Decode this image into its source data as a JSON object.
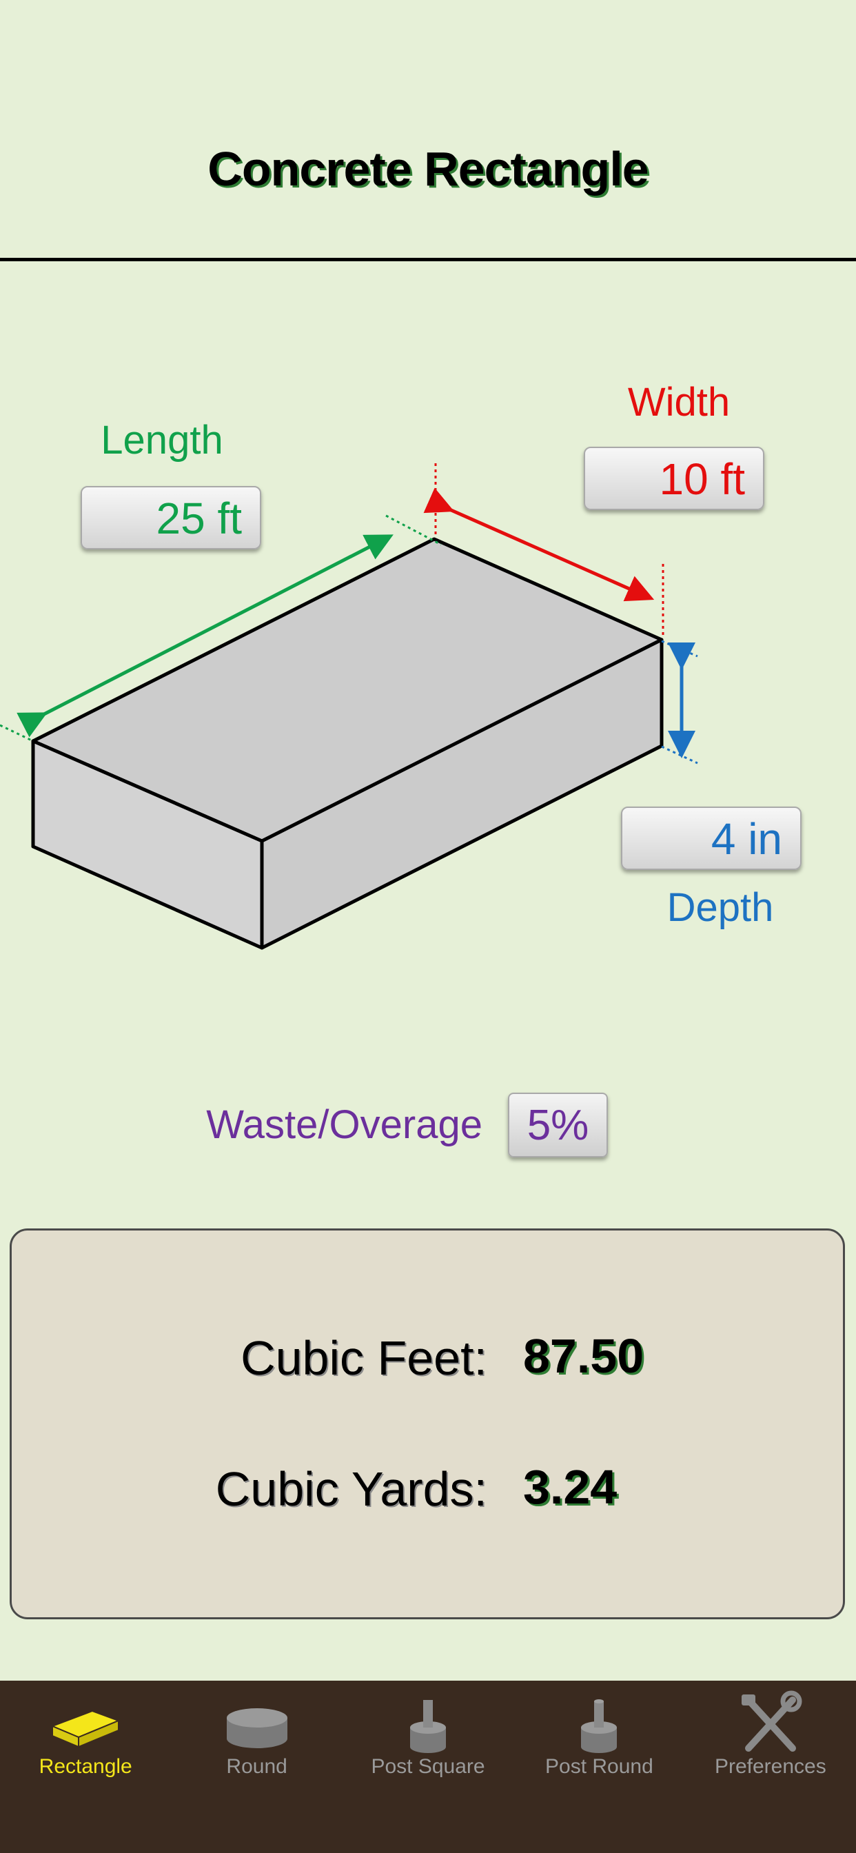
{
  "header": {
    "title": "Concrete Rectangle"
  },
  "diagram": {
    "length": {
      "label": "Length",
      "value": "25 ft",
      "color": "#10a14b"
    },
    "width": {
      "label": "Width",
      "value": "10 ft",
      "color": "#e40e0e"
    },
    "depth": {
      "label": "Depth",
      "value": "4 in",
      "color": "#1d72c2"
    }
  },
  "waste": {
    "label": "Waste/Overage",
    "value": "5%",
    "color": "#6b2f9c"
  },
  "results": {
    "cubic_feet_label": "Cubic Feet:",
    "cubic_feet_value": "87.50",
    "cubic_yards_label": "Cubic Yards:",
    "cubic_yards_value": "3.24"
  },
  "tabs": [
    {
      "label": "Rectangle",
      "icon": "slab-icon",
      "active": true
    },
    {
      "label": "Round",
      "icon": "cylinder-icon",
      "active": false
    },
    {
      "label": "Post Square",
      "icon": "post-square-icon",
      "active": false
    },
    {
      "label": "Post Round",
      "icon": "post-round-icon",
      "active": false
    },
    {
      "label": "Preferences",
      "icon": "tools-icon",
      "active": false
    }
  ],
  "colors": {
    "background": "#e6f0d7",
    "panel": "#e2ddcd",
    "tabbar": "#3a2a1f",
    "active_tab": "#f4e61a"
  }
}
